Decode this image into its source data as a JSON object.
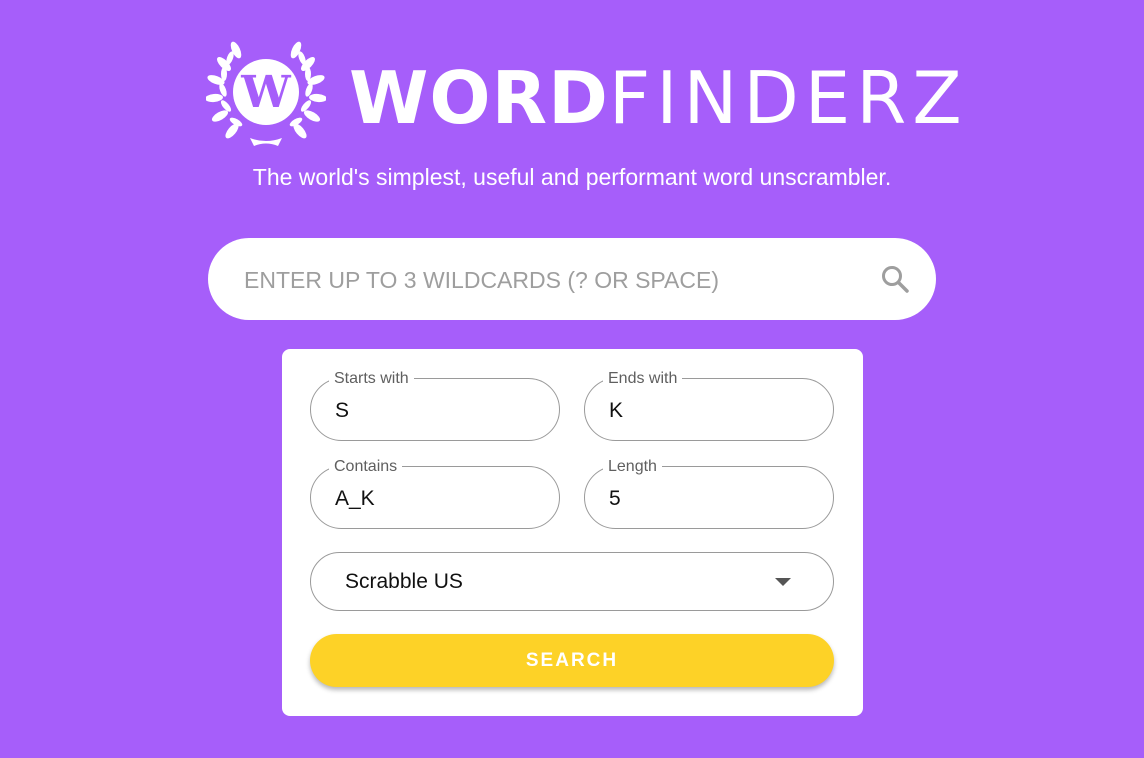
{
  "brand": {
    "emblem_letter": "W",
    "wordmark_bold": "WORD",
    "wordmark_light": "FINDERZ"
  },
  "tagline": "The world's simplest, useful and performant word unscrambler.",
  "search": {
    "placeholder": "ENTER UP TO 3 WILDCARDS (? OR SPACE)",
    "value": "",
    "icon": "search-icon"
  },
  "filters": {
    "starts_with": {
      "label": "Starts with",
      "value": "S"
    },
    "ends_with": {
      "label": "Ends with",
      "value": "K"
    },
    "contains": {
      "label": "Contains",
      "value": "A_K"
    },
    "length": {
      "label": "Length",
      "value": "5"
    }
  },
  "dictionary": {
    "selected": "Scrabble US"
  },
  "search_button_label": "SEARCH",
  "colors": {
    "background": "#a65efa",
    "accent_button": "#fdd227",
    "panel": "#ffffff"
  }
}
